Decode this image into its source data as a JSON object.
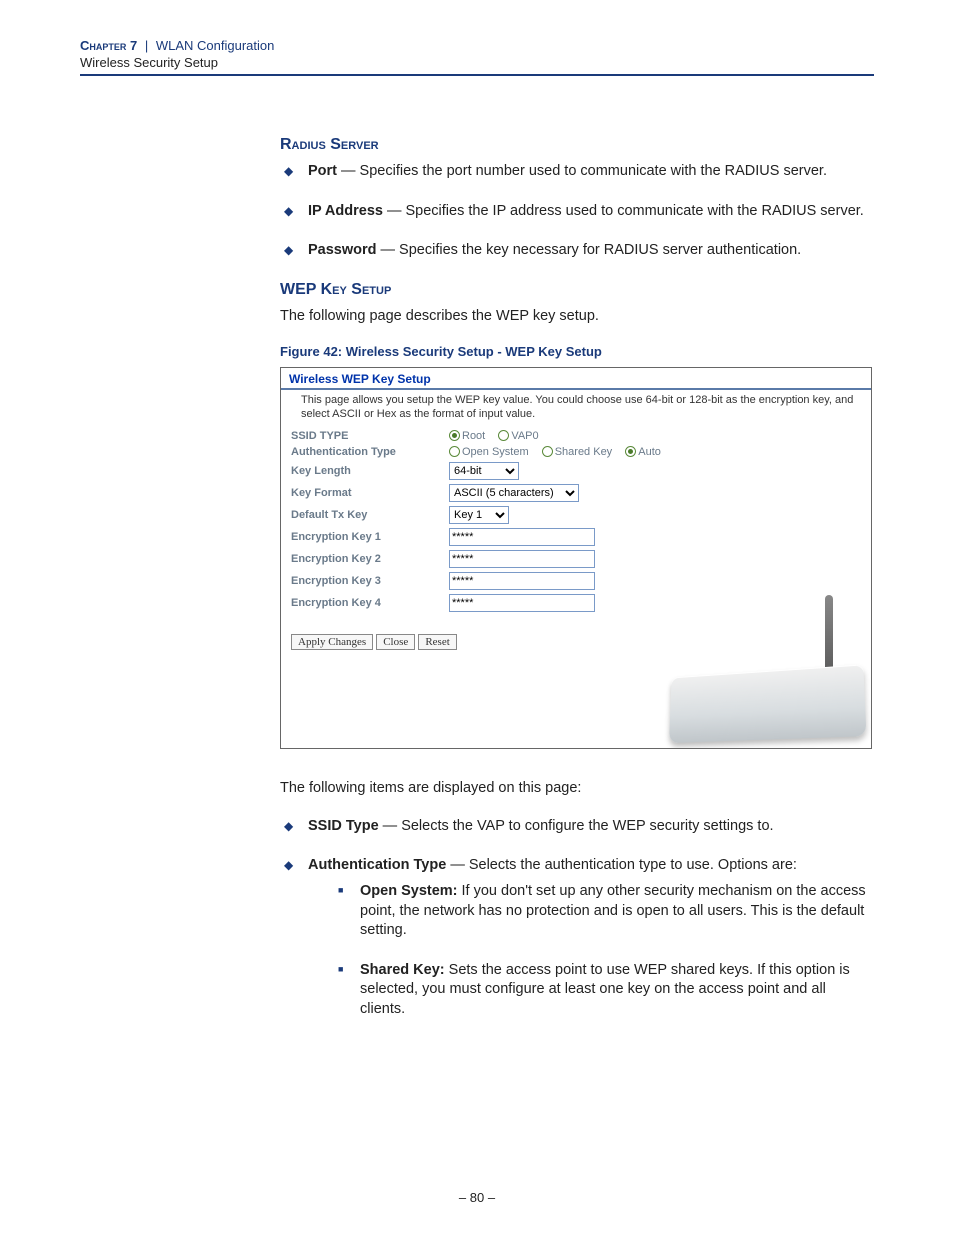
{
  "header": {
    "chapter": "Chapter 7",
    "sep": "|",
    "title": "WLAN Configuration",
    "subtitle": "Wireless Security Setup"
  },
  "radius": {
    "heading": "Radius Server",
    "items": [
      {
        "term": "Port",
        "desc": " — Specifies the port number used to communicate with the RADIUS server."
      },
      {
        "term": "IP Address",
        "desc": " — Specifies the IP address used to communicate with the RADIUS server."
      },
      {
        "term": "Password",
        "desc": " — Specifies the key necessary for RADIUS server authentication."
      }
    ]
  },
  "wep": {
    "heading": "WEP Key Setup",
    "intro": "The following page describes the WEP key setup.",
    "figcap": "Figure 42:  Wireless Security Setup - WEP Key Setup",
    "after": "The following items are displayed on this page:",
    "items": [
      {
        "term": "SSID Type",
        "desc": " — Selects the VAP to configure the WEP security settings to."
      },
      {
        "term": "Authentication Type",
        "desc": " — Selects the authentication type to use. Options are:"
      }
    ],
    "subitems": [
      {
        "term": "Open System:",
        "desc": " If you don't set up any other security mechanism on the access point, the network has no protection and is open to all users. This is the default setting."
      },
      {
        "term": "Shared Key:",
        "desc": " Sets the access point to use WEP shared keys. If this option is selected, you must configure at least one key on the access point and all clients."
      }
    ]
  },
  "shot": {
    "title": "Wireless WEP Key Setup",
    "desc": "This page allows you setup the WEP key value. You could choose use 64-bit or 128-bit as the encryption key, and select ASCII or Hex as the format of input value.",
    "labels": {
      "ssid": "SSID TYPE",
      "auth": "Authentication Type",
      "keylen": "Key Length",
      "keyfmt": "Key Format",
      "deftx": "Default Tx Key",
      "ek1": "Encryption Key 1",
      "ek2": "Encryption Key 2",
      "ek3": "Encryption Key 3",
      "ek4": "Encryption Key 4"
    },
    "radios": {
      "root": "Root",
      "vap0": "VAP0",
      "open": "Open System",
      "shared": "Shared Key",
      "auto": "Auto"
    },
    "selects": {
      "keylen": "64-bit",
      "keyfmt": "ASCII (5 characters)",
      "deftx": "Key 1"
    },
    "keyval": "*****",
    "buttons": {
      "apply": "Apply Changes",
      "close": "Close",
      "reset": "Reset"
    }
  },
  "pagenum": "–  80  –"
}
